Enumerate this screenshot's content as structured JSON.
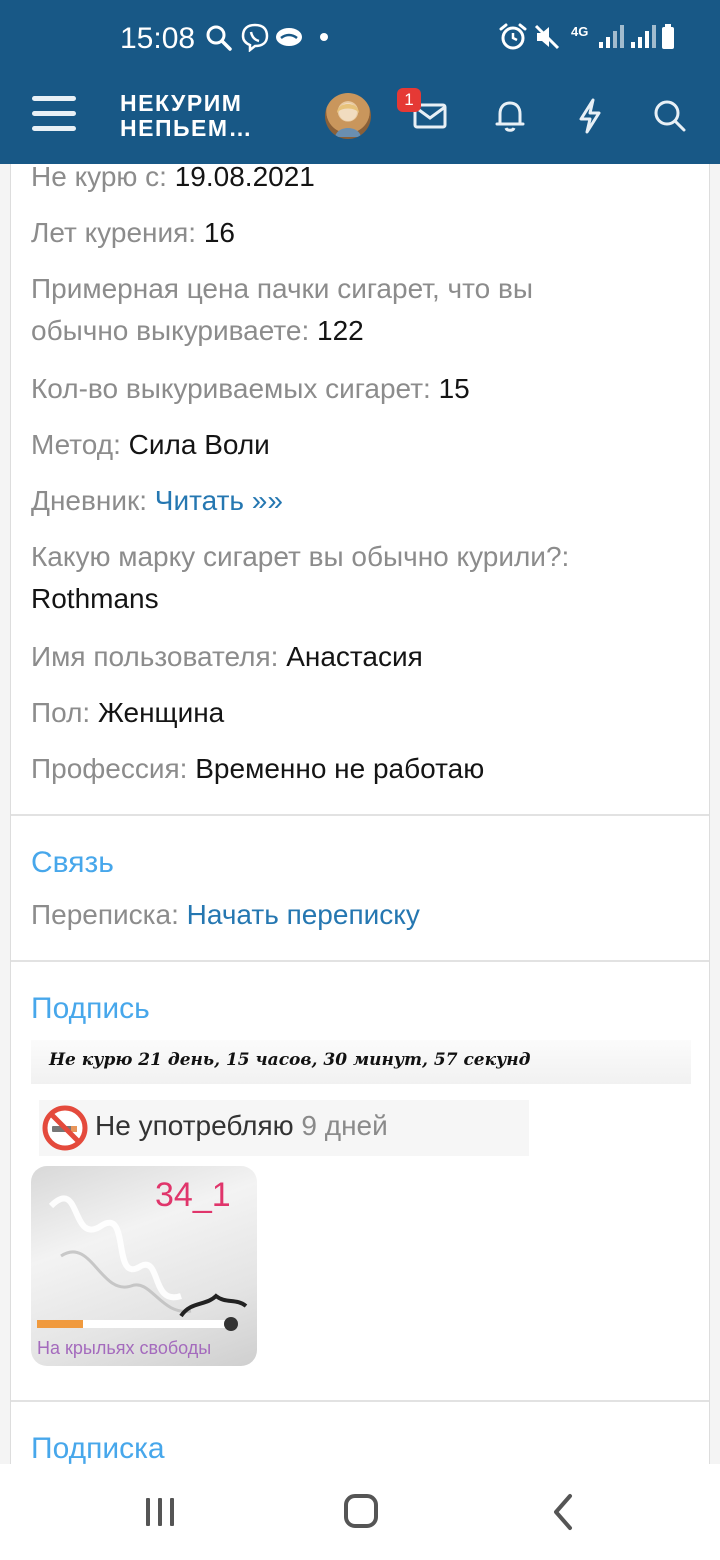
{
  "status_bar": {
    "time": "15:08",
    "signal_label": "4G"
  },
  "header": {
    "logo_line1": "НЕКУРИМ",
    "logo_line2": "НЕПЬЕМ…",
    "notification_count": "1",
    "colors": {
      "brand": "#185886",
      "badge": "#e53935"
    }
  },
  "profile": {
    "fields": [
      {
        "label": "Не курю с:",
        "value": "19.08.2021"
      },
      {
        "label": "Лет курения:",
        "value": "16"
      },
      {
        "label_line1": "Примерная цена пачки сигарет, что вы",
        "label_line2": "обычно выкуриваете:",
        "value": "122"
      },
      {
        "label": "Кол-во выкуриваемых сигарет:",
        "value": "15"
      },
      {
        "label": "Метод:",
        "value": "Сила Воли"
      },
      {
        "label": "Дневник:",
        "value": "Читать »»"
      },
      {
        "label": "Какую марку сигарет вы обычно курили?:",
        "value": "Rothmans"
      },
      {
        "label": "Имя пользователя:",
        "value": "Анастасия"
      },
      {
        "label": "Пол:",
        "value": "Женщина"
      },
      {
        "label": "Профессия:",
        "value": "Временно не работаю"
      }
    ]
  },
  "contact": {
    "title": "Связь",
    "label": "Переписка:",
    "link": "Начать переписку"
  },
  "signature": {
    "title": "Подпись",
    "counter_text": "Не курю 21 день, 15 часов, 30 минут, 57 секунд",
    "no_use_text": "Не употребляю",
    "no_use_days": "9 дней",
    "badge_number": "34_1",
    "badge_caption": "На крыльях свободы"
  },
  "subscription": {
    "title": "Подписка"
  },
  "colors": {
    "section_title": "#47a7eb",
    "link": "#2577b1",
    "label": "#8c8c8c"
  }
}
